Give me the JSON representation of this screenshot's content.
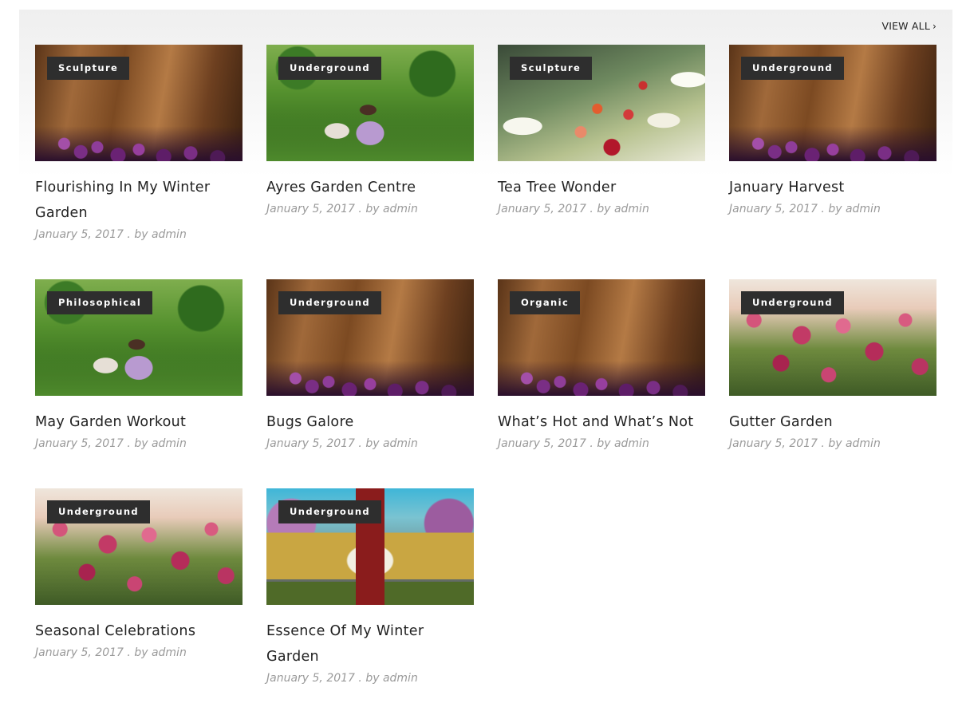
{
  "header": {
    "view_all_label": "VIEW ALL"
  },
  "posts": [
    {
      "category": "Sculpture",
      "title": "Flourishing In My Winter Garden",
      "date": "January 5, 2017",
      "by": "by admin",
      "image": "flowers"
    },
    {
      "category": "Underground",
      "title": "Ayres Garden Centre",
      "date": "January 5, 2017",
      "by": "by admin",
      "image": "girl"
    },
    {
      "category": "Sculpture",
      "title": "Tea Tree Wonder",
      "date": "January 5, 2017",
      "by": "by admin",
      "image": "white"
    },
    {
      "category": "Underground",
      "title": "January Harvest",
      "date": "January 5, 2017",
      "by": "by admin",
      "image": "flowers"
    },
    {
      "category": "Philosophical",
      "title": "May Garden Workout",
      "date": "January 5, 2017",
      "by": "by admin",
      "image": "girl"
    },
    {
      "category": "Underground",
      "title": "Bugs Galore",
      "date": "January 5, 2017",
      "by": "by admin",
      "image": "flowers"
    },
    {
      "category": "Organic",
      "title": "What’s Hot and What’s Not",
      "date": "January 5, 2017",
      "by": "by admin",
      "image": "flowers"
    },
    {
      "category": "Underground",
      "title": "Gutter Garden",
      "date": "January 5, 2017",
      "by": "by admin",
      "image": "pink"
    },
    {
      "category": "Underground",
      "title": "Seasonal Celebrations",
      "date": "January 5, 2017",
      "by": "by admin",
      "image": "pink"
    },
    {
      "category": "Underground",
      "title": "Essence Of My Winter Garden",
      "date": "January 5, 2017",
      "by": "by admin",
      "image": "house"
    }
  ]
}
